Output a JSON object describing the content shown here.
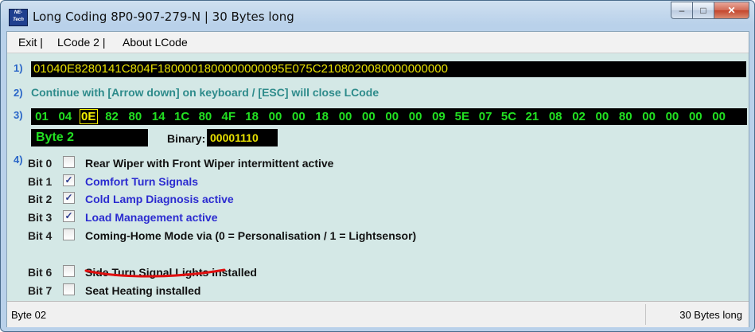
{
  "window": {
    "title": "Long Coding  8P0-907-279-N | 30 Bytes long",
    "app_icon": "ne-tech-icon",
    "app_icon_text_1": "NE-",
    "app_icon_text_2": "Tech",
    "minimize_glyph": "–",
    "maximize_glyph": "□",
    "close_glyph": "✕"
  },
  "menu": {
    "items": [
      {
        "label": "Exit |"
      },
      {
        "label": "LCode 2 |"
      },
      {
        "label": "About LCode"
      }
    ]
  },
  "step1": {
    "num": "1)",
    "hex_string": "01040E8280141C804F1800001800000000095E075C2108020080000000000"
  },
  "step2": {
    "num": "2)",
    "hint": "Continue with [Arrow down] on keyboard / [ESC] will close LCode"
  },
  "step3": {
    "num": "3)",
    "bytes": [
      "01",
      "04",
      "0E",
      "82",
      "80",
      "14",
      "1C",
      "80",
      "4F",
      "18",
      "00",
      "00",
      "18",
      "00",
      "00",
      "00",
      "00",
      "09",
      "5E",
      "07",
      "5C",
      "21",
      "08",
      "02",
      "00",
      "80",
      "00",
      "00",
      "00",
      "00"
    ],
    "selected_index": 2,
    "byte_label": "Byte 2",
    "binary_label": "Binary:",
    "binary_value": "00001110"
  },
  "step4": {
    "num": "4)",
    "bits": [
      {
        "name": "Bit 0",
        "checked": false,
        "desc": "Rear Wiper with Front Wiper intermittent active",
        "color": "#111111"
      },
      {
        "name": "Bit 1",
        "checked": true,
        "desc": "Comfort Turn Signals",
        "color": "#2b2bd0"
      },
      {
        "name": "Bit 2",
        "checked": true,
        "desc": "Cold Lamp Diagnosis active",
        "color": "#2b2bd0"
      },
      {
        "name": "Bit 3",
        "checked": true,
        "desc": "Load Management active",
        "color": "#2b2bd0"
      },
      {
        "name": "Bit 4",
        "checked": false,
        "desc": "Coming-Home Mode via (0 = Personalisation / 1 = Lightsensor)",
        "color": "#111111"
      },
      {
        "name": "Bit 6",
        "checked": false,
        "desc": "Side Turn Signal Lights installed",
        "color": "#111111"
      },
      {
        "name": "Bit 7",
        "checked": false,
        "desc": "Seat Heating installed",
        "color": "#111111"
      }
    ],
    "check_glyph": "✓"
  },
  "status": {
    "left": "Byte 02",
    "right": "30 Bytes long"
  },
  "colors": {
    "hex_text": "#e7e000",
    "byte_green": "#22e022",
    "hint_teal": "#2e8b8b",
    "annotation_red": "#e01010"
  }
}
